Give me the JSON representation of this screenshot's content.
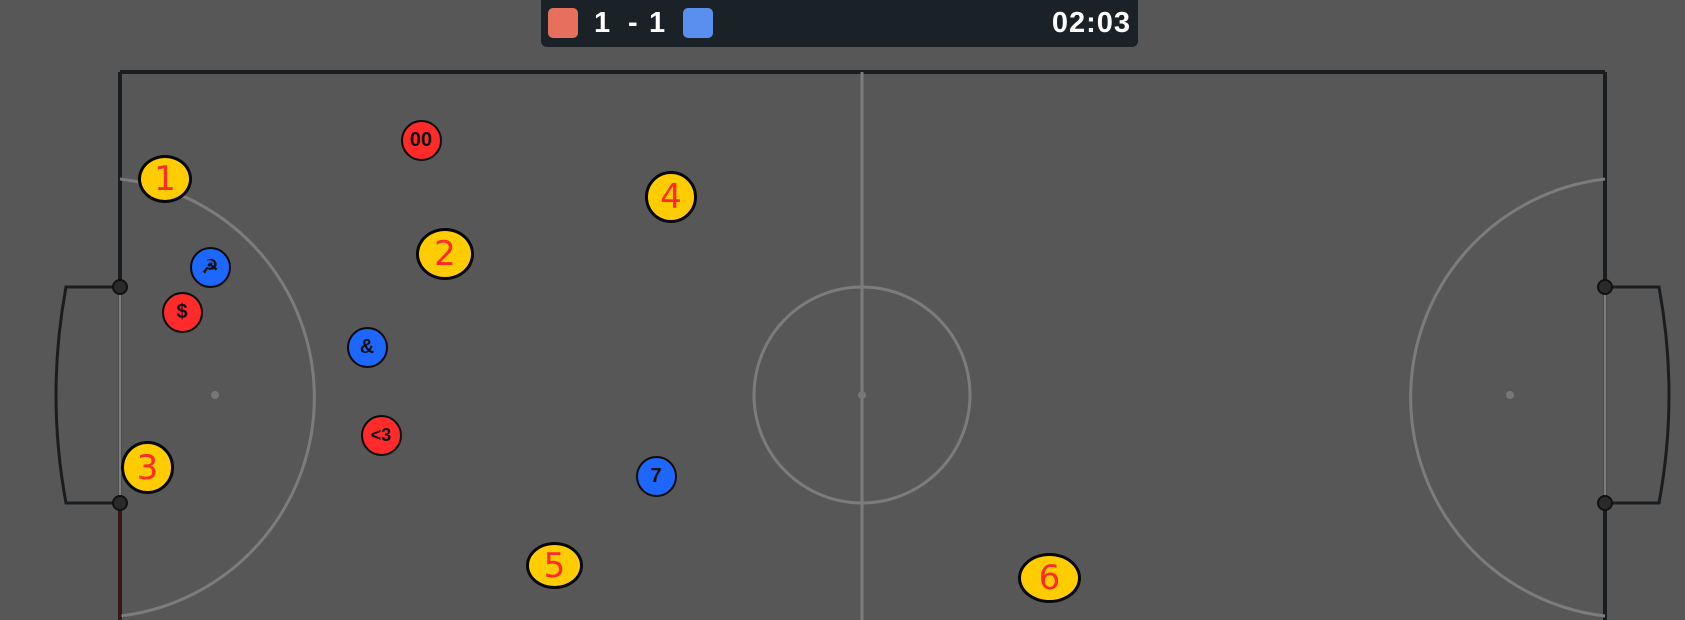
{
  "scoreboard": {
    "red_score": "1",
    "separator": "-",
    "blue_score": "1",
    "time": "02:03",
    "colors": {
      "red": "#e66f5d",
      "blue": "#5a8ff0"
    }
  },
  "players": [
    {
      "team": "red",
      "label": "00"
    },
    {
      "team": "blue",
      "label": "☭"
    },
    {
      "team": "red",
      "label": "$"
    },
    {
      "team": "blue",
      "label": "&"
    },
    {
      "team": "red",
      "label": "<3"
    },
    {
      "team": "blue",
      "label": "7"
    }
  ],
  "markers": [
    {
      "label": "1"
    },
    {
      "label": "2"
    },
    {
      "label": "3"
    },
    {
      "label": "4"
    },
    {
      "label": "5"
    },
    {
      "label": "6"
    }
  ],
  "team_colors": {
    "red": "#ff2a2a",
    "blue": "#1d67ff"
  },
  "marker_colors": {
    "fill": "#ffcc00",
    "text": "#ff2a2a"
  }
}
